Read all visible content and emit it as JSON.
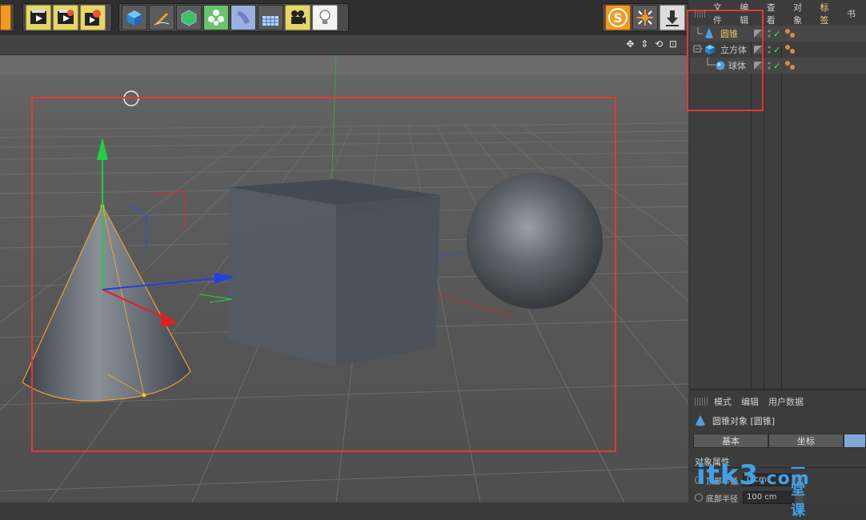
{
  "object_manager": {
    "menu": [
      "文件",
      "编辑",
      "查看",
      "对象",
      "标签",
      "书"
    ],
    "active_menu": "标签",
    "objects": [
      {
        "name": "圆锥",
        "selected": true,
        "icon": "cone-icon"
      },
      {
        "name": "立方体",
        "selected": false,
        "icon": "cube-icon"
      },
      {
        "name": "球体",
        "selected": false,
        "icon": "sphere-icon"
      }
    ]
  },
  "attributes": {
    "menu": [
      "模式",
      "编辑",
      "用户数据"
    ],
    "title": "圆锥对象 [圆锥]",
    "tabs": [
      "基本",
      "坐标"
    ],
    "section": "对象属性",
    "params": [
      {
        "label": "顶部半径",
        "value": "0 cm"
      },
      {
        "label": "底部半径",
        "value": "100 cm"
      }
    ]
  },
  "viewport": {
    "nav_icons": "✥ ⇕ ⟲ ⊡"
  },
  "toolbar": {
    "icons": [
      "undo-icon",
      "render-view-icon",
      "render-picture-icon",
      "render-settings-icon",
      "cube-icon",
      "pen-icon",
      "subdivision-icon",
      "cloner-icon",
      "deformer-icon",
      "floor-icon",
      "camera-icon",
      "light-icon",
      "snap-icon",
      "axis-icon",
      "drop-icon"
    ]
  },
  "watermark": {
    "text": "itk3",
    "suffix": ".com",
    "chinese": "一堂课"
  },
  "colors": {
    "selected": "#f5c15a",
    "accent": "#f0d76a",
    "highlight_box": "#e23a32"
  }
}
